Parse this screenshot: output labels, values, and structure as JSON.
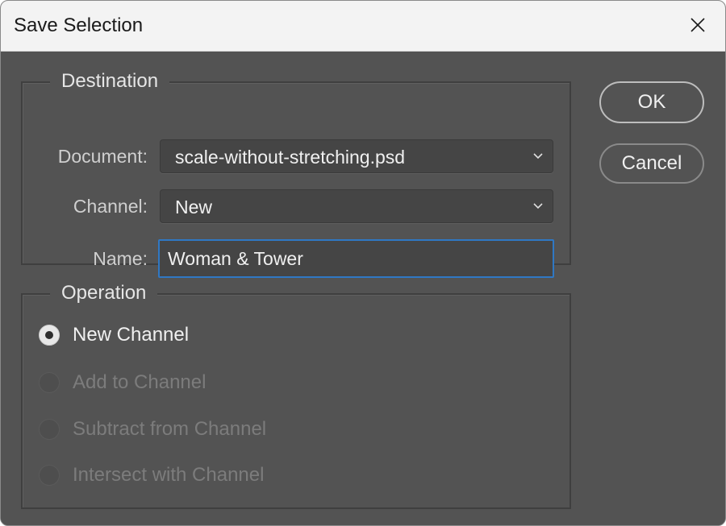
{
  "window": {
    "title": "Save Selection"
  },
  "destination": {
    "legend": "Destination",
    "document_label": "Document:",
    "document_value": "scale-without-stretching.psd",
    "channel_label": "Channel:",
    "channel_value": "New",
    "name_label": "Name:",
    "name_value": "Woman & Tower"
  },
  "operation": {
    "legend": "Operation",
    "options": [
      {
        "label": "New Channel",
        "checked": true,
        "enabled": true
      },
      {
        "label": "Add to Channel",
        "checked": false,
        "enabled": false
      },
      {
        "label": "Subtract from Channel",
        "checked": false,
        "enabled": false
      },
      {
        "label": "Intersect with Channel",
        "checked": false,
        "enabled": false
      }
    ]
  },
  "buttons": {
    "ok_label": "OK",
    "cancel_label": "Cancel"
  },
  "icons": {
    "close": "close-icon",
    "chevron": "chevron-down-icon"
  },
  "colors": {
    "dialog_bg": "#535353",
    "titlebar_bg": "#f3f3f3",
    "focus_border": "#2f78c4"
  }
}
